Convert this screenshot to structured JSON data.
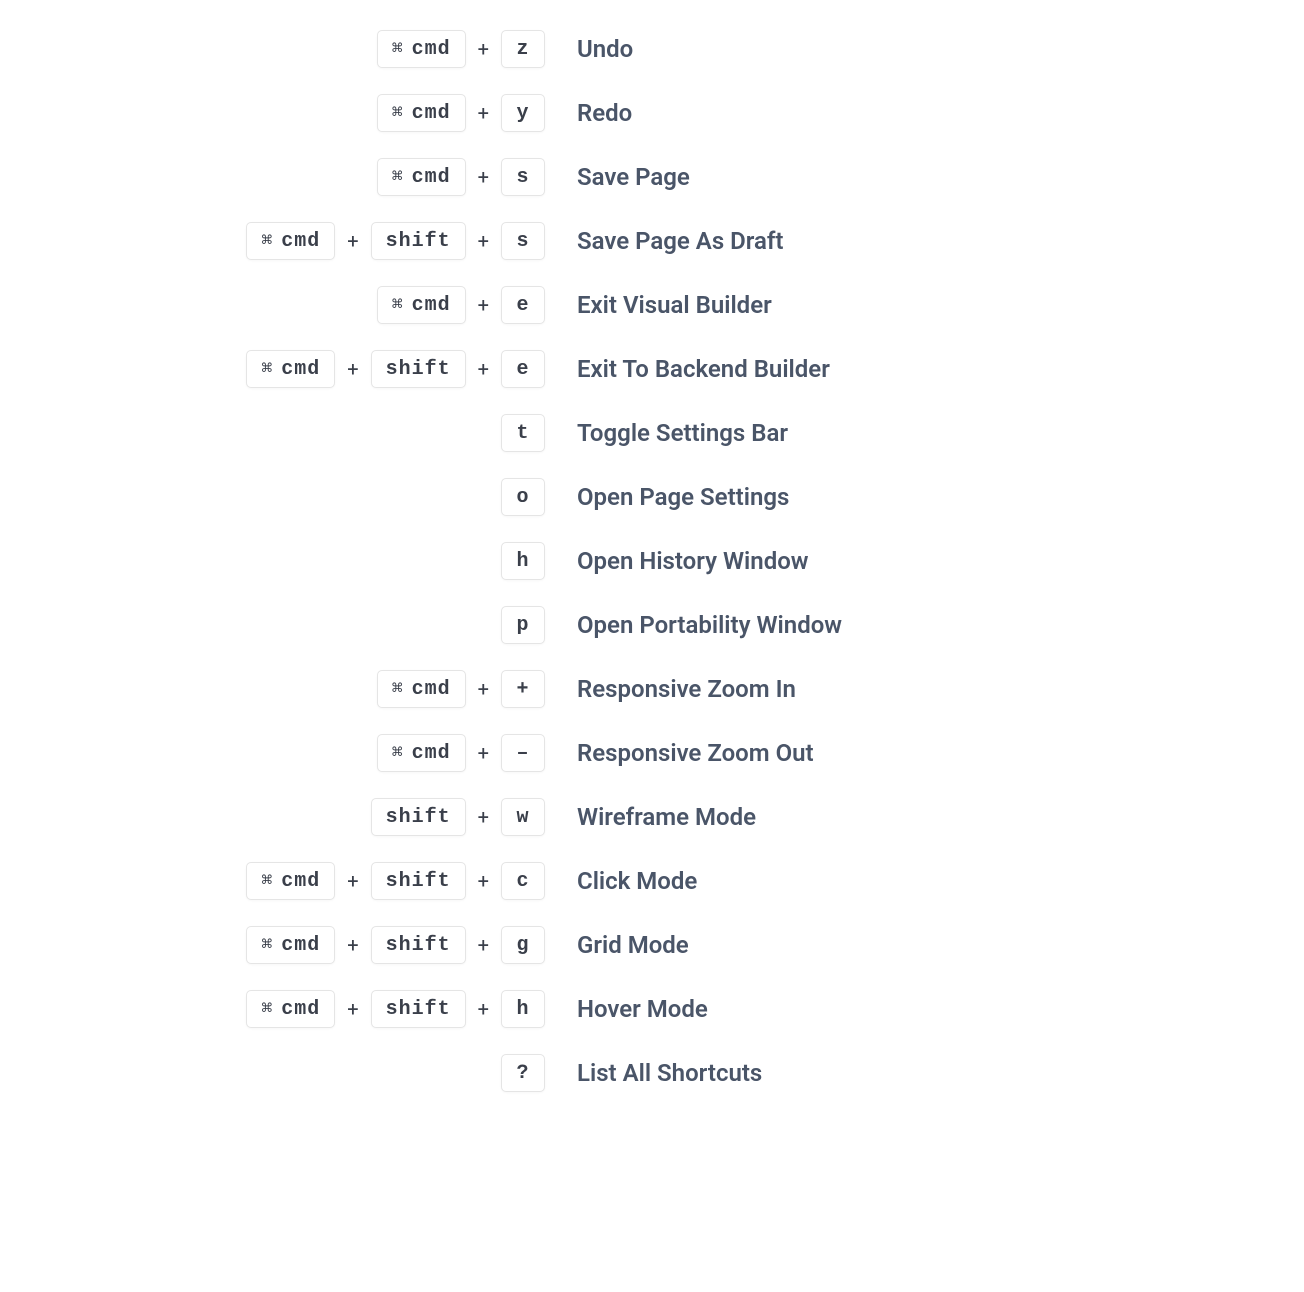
{
  "cmd_label": "cmd",
  "shift_label": "shift",
  "plus": "+",
  "shortcuts": [
    {
      "keys": [
        {
          "type": "cmd"
        },
        {
          "type": "letter",
          "val": "z"
        }
      ],
      "desc": "Undo"
    },
    {
      "keys": [
        {
          "type": "cmd"
        },
        {
          "type": "letter",
          "val": "y"
        }
      ],
      "desc": "Redo"
    },
    {
      "keys": [
        {
          "type": "cmd"
        },
        {
          "type": "letter",
          "val": "s"
        }
      ],
      "desc": "Save Page"
    },
    {
      "keys": [
        {
          "type": "cmd"
        },
        {
          "type": "shift"
        },
        {
          "type": "letter",
          "val": "s"
        }
      ],
      "desc": "Save Page As Draft"
    },
    {
      "keys": [
        {
          "type": "cmd"
        },
        {
          "type": "letter",
          "val": "e"
        }
      ],
      "desc": "Exit Visual Builder"
    },
    {
      "keys": [
        {
          "type": "cmd"
        },
        {
          "type": "shift"
        },
        {
          "type": "letter",
          "val": "e"
        }
      ],
      "desc": "Exit To Backend Builder"
    },
    {
      "keys": [
        {
          "type": "letter",
          "val": "t"
        }
      ],
      "desc": "Toggle Settings Bar"
    },
    {
      "keys": [
        {
          "type": "letter",
          "val": "o"
        }
      ],
      "desc": "Open Page Settings"
    },
    {
      "keys": [
        {
          "type": "letter",
          "val": "h"
        }
      ],
      "desc": "Open History Window"
    },
    {
      "keys": [
        {
          "type": "letter",
          "val": "p"
        }
      ],
      "desc": "Open Portability Window"
    },
    {
      "keys": [
        {
          "type": "cmd"
        },
        {
          "type": "letter",
          "val": "+"
        }
      ],
      "desc": "Responsive Zoom In"
    },
    {
      "keys": [
        {
          "type": "cmd"
        },
        {
          "type": "letter",
          "val": "–"
        }
      ],
      "desc": "Responsive Zoom Out"
    },
    {
      "keys": [
        {
          "type": "shift"
        },
        {
          "type": "letter",
          "val": "w"
        }
      ],
      "desc": "Wireframe Mode"
    },
    {
      "keys": [
        {
          "type": "cmd"
        },
        {
          "type": "shift"
        },
        {
          "type": "letter",
          "val": "c"
        }
      ],
      "desc": "Click Mode"
    },
    {
      "keys": [
        {
          "type": "cmd"
        },
        {
          "type": "shift"
        },
        {
          "type": "letter",
          "val": "g"
        }
      ],
      "desc": "Grid Mode"
    },
    {
      "keys": [
        {
          "type": "cmd"
        },
        {
          "type": "shift"
        },
        {
          "type": "letter",
          "val": "h"
        }
      ],
      "desc": "Hover Mode"
    },
    {
      "keys": [
        {
          "type": "letter",
          "val": "?"
        }
      ],
      "desc": "List All Shortcuts"
    }
  ]
}
